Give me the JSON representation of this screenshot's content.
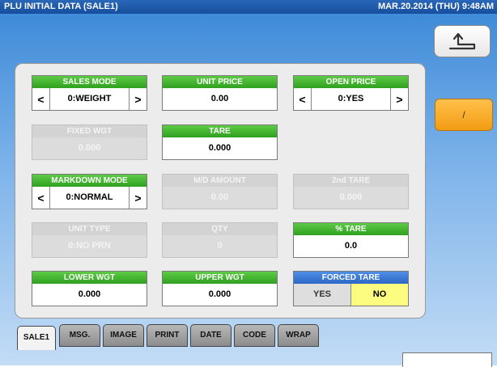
{
  "title": "PLU INITIAL DATA (SALE1)",
  "datetime": "MAR.20.2014 (THU)  9:48AM",
  "slash_label": "/",
  "fields": {
    "sales_mode": {
      "label": "SALES MODE",
      "value": "0:WEIGHT"
    },
    "unit_price": {
      "label": "UNIT PRICE",
      "value": "0.00"
    },
    "open_price": {
      "label": "OPEN PRICE",
      "value": "0:YES"
    },
    "fixed_wgt": {
      "label": "FIXED WGT",
      "value": "0.000"
    },
    "tare": {
      "label": "TARE",
      "value": "0.000"
    },
    "markdown_mode": {
      "label": "MARKDOWN MODE",
      "value": "0:NORMAL"
    },
    "md_amount": {
      "label": "M/D AMOUNT",
      "value": "0.00"
    },
    "second_tare": {
      "label": "2nd TARE",
      "value": "0.000"
    },
    "unit_type": {
      "label": "UNIT TYPE",
      "value": "0:NO PRN"
    },
    "qty": {
      "label": "QTY",
      "value": "0"
    },
    "pct_tare": {
      "label": "% TARE",
      "value": "0.0"
    },
    "lower_wgt": {
      "label": "LOWER WGT",
      "value": "0.000"
    },
    "upper_wgt": {
      "label": "UPPER WGT",
      "value": "0.000"
    },
    "forced_tare": {
      "label": "FORCED TARE",
      "yes": "YES",
      "no": "NO"
    }
  },
  "arrows": {
    "left": "<",
    "right": ">"
  },
  "tabs": [
    "SALE1",
    "MSG.",
    "IMAGE",
    "PRINT",
    "DATE",
    "CODE",
    "WRAP"
  ],
  "active_tab": "SALE1"
}
